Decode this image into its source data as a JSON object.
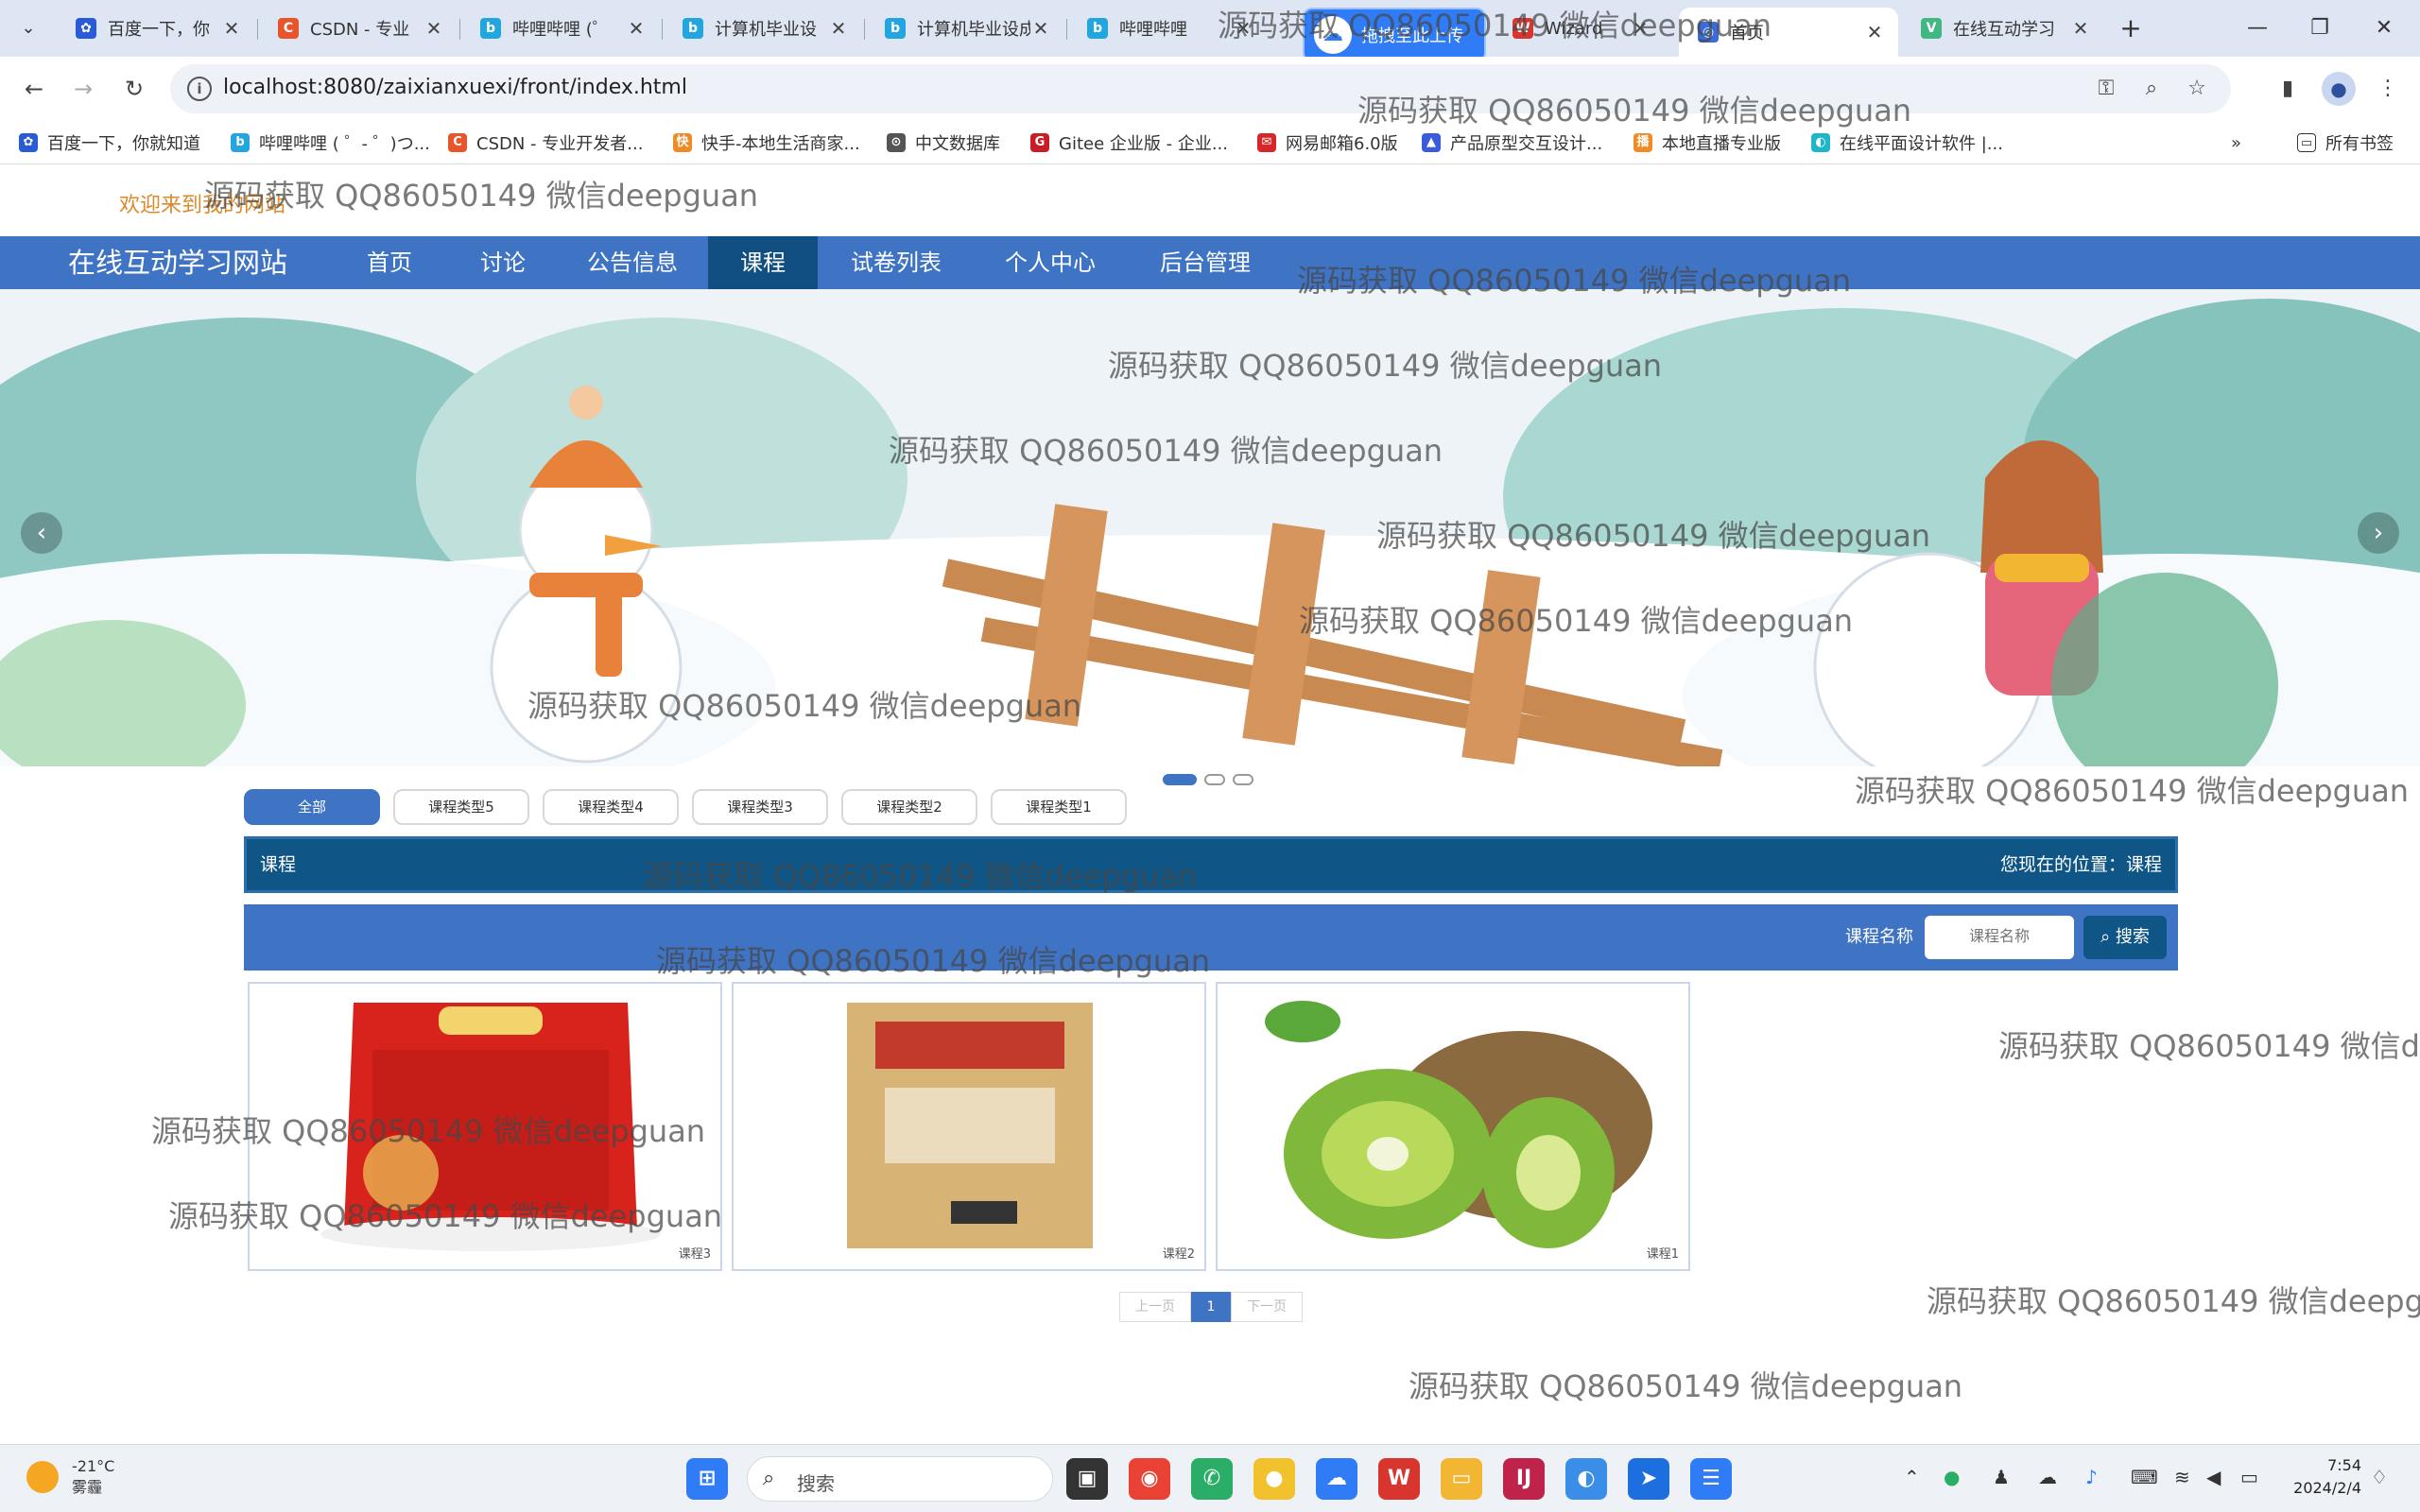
{
  "browser": {
    "tabs": [
      {
        "title": "百度一下，你",
        "color": "#2a5bd7",
        "glyph": "✿"
      },
      {
        "title": "CSDN - 专业",
        "color": "#e8552c",
        "glyph": "C"
      },
      {
        "title": "哔哩哔哩 (゜",
        "color": "#23a6e0",
        "glyph": "b"
      },
      {
        "title": "计算机毕业设",
        "color": "#23a6e0",
        "glyph": "b"
      },
      {
        "title": "计算机毕业设成",
        "color": "#23a6e0",
        "glyph": "b"
      },
      {
        "title": "哔哩哔哩",
        "color": "#23a6e0",
        "glyph": "b"
      },
      {
        "title": "Wizard",
        "color": "#d9352f",
        "glyph": "W"
      },
      {
        "title": "首页",
        "color": "#3b6bd6",
        "glyph": "◎"
      },
      {
        "title": "在线互动学习",
        "color": "#41b883",
        "glyph": "V"
      }
    ],
    "upload_badge": "拖拽至此上传",
    "url": "localhost:8080/zaixianxuexi/front/index.html",
    "bookmarks": [
      {
        "label": "百度一下，你就知道",
        "color": "#2a5bd7",
        "glyph": "✿"
      },
      {
        "label": "哔哩哔哩 ( ゜- ゜)つ...",
        "color": "#23a6e0",
        "glyph": "b"
      },
      {
        "label": "CSDN - 专业开发者...",
        "color": "#e8552c",
        "glyph": "C"
      },
      {
        "label": "快手-本地生活商家...",
        "color": "#f08a24",
        "glyph": "快"
      },
      {
        "label": "中文数据库",
        "color": "#555555",
        "glyph": "⊙"
      },
      {
        "label": "Gitee 企业版 - 企业...",
        "color": "#c71d23",
        "glyph": "G"
      },
      {
        "label": "网易邮箱6.0版",
        "color": "#d6262a",
        "glyph": "✉"
      },
      {
        "label": "产品原型交互设计...",
        "color": "#3b5bdb",
        "glyph": "▲"
      },
      {
        "label": "本地直播专业版",
        "color": "#f08a24",
        "glyph": "播"
      },
      {
        "label": "在线平面设计软件 |...",
        "color": "#1fb6c9",
        "glyph": "◐"
      }
    ],
    "bookmarks_all": "所有书签"
  },
  "page": {
    "welcome": "欢迎来到我的网站",
    "site_title": "在线互动学习网站",
    "nav": [
      "首页",
      "讨论",
      "公告信息",
      "课程",
      "试卷列表",
      "个人中心",
      "后台管理"
    ],
    "active_nav": "课程",
    "filters": [
      "全部",
      "课程类型5",
      "课程类型4",
      "课程类型3",
      "课程类型2",
      "课程类型1"
    ],
    "crumb_left": "课程",
    "crumb_right": "您现在的位置：课程",
    "search_label": "课程名称",
    "search_placeholder": "课程名称",
    "search_button": "搜索",
    "cards": [
      {
        "caption": "课程3",
        "image": "rice-bag"
      },
      {
        "caption": "课程2",
        "image": "millet-package"
      },
      {
        "caption": "课程1",
        "image": "kiwi-fruit"
      }
    ],
    "pager": {
      "prev": "上一页",
      "current": "1",
      "next": "下一页"
    }
  },
  "watermark_text": "源码获取 QQ86050149 微信deepguan",
  "taskbar": {
    "temperature": "-21°C",
    "weather": "雾霾",
    "search": "搜索",
    "time": "7:54",
    "date": "2024/2/4"
  }
}
